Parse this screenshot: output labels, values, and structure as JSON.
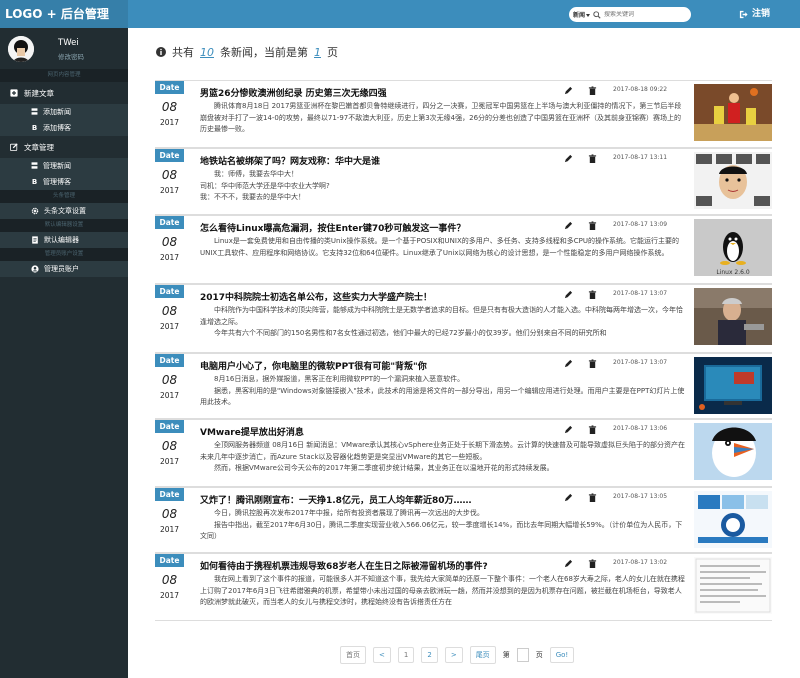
{
  "header": {
    "logo": "LOGO + 后台管理",
    "search_select": "新闻",
    "search_placeholder": "搜索关键词",
    "logout_label": "注销"
  },
  "user": {
    "name": "TWei",
    "subtitle": "修改密码"
  },
  "sidebar": {
    "sec1": "网页内容管理",
    "group1": "新建文章",
    "g1_items": [
      {
        "mark": "〓",
        "label": "添加新闻"
      },
      {
        "mark": "B",
        "label": "添加博客"
      }
    ],
    "group2": "文章管理",
    "g2_items": [
      {
        "mark": "〓",
        "label": "管理新闻"
      },
      {
        "mark": "B",
        "label": "管理博客"
      }
    ],
    "sec2": "头条管理",
    "headline_settings": "头条文章设置",
    "sec3": "默认编辑器设置",
    "default_editor": "默认编辑器",
    "sec4": "管理员账户设置",
    "admin_account": "管理员账户"
  },
  "summary": {
    "prefix": "共有",
    "count": "10",
    "middle": "条新闻，当前是第",
    "page": "1",
    "suffix": "页"
  },
  "articles": [
    {
      "date_label": "Date",
      "day": "08",
      "year": "2017",
      "title": "男篮26分惨败澳洲创纪录 历史第三次无缘四强",
      "time": "2017-08-18 09:22",
      "body": "　　腾讯体育8月18日 2017男篮亚洲杯在黎巴嫩首都贝鲁特继续进行，四分之一决赛，卫冕冠军中国男篮在上半场与澳大利亚僵持的情况下，第三节后半段崩盘被对手打了一波14-0的攻势，最终以71-97不敌澳大利亚，历史上第3次无缘4强，26分的分差也创造了中国男篮在亚洲杯（及其前身亚锦赛）赛场上的历史最惨一败。"
    },
    {
      "date_label": "Date",
      "day": "08",
      "year": "2017",
      "title": "地铁站名被绑架了吗？网友戏称：华中大是谁",
      "time": "2017-08-17 13:11",
      "body": "　　我：师傅，我要去华中大！\n司机：华中师范大学还是华中农业大学啊?\n我：不不不，我要去的是华中大！"
    },
    {
      "date_label": "Date",
      "day": "08",
      "year": "2017",
      "title": "怎么看待Linux曝高危漏洞，按住Enter键70秒可触发这一事件？",
      "time": "2017-08-17 13:09",
      "body": "　　Linux是一套免费使用和自由传播的类Unix操作系统。是一个基于POSIX和UNIX的多用户、多任务、支持多线程和多CPU的操作系统。它能运行主要的UNIX工具软件、应用程序和网络协议。它支持32位和64位硬件。Linux继承了Unix以网络为核心的设计思想，是一个性能稳定的多用户网络操作系统。"
    },
    {
      "date_label": "Date",
      "day": "08",
      "year": "2017",
      "title": "2017中科院院士初选名单公布，这些实力大学盛产院士！",
      "time": "2017-08-17 13:07",
      "body": "　　中科院作为中国科学技术的顶尖阵营，能够成为中科院院士是无数学者追求的目标。但是只有有极大造诣的人才能入选。中科院每两年增选一次，今年恰逢增选之际。\n　　今年共有六个不同部门的150名男性和7名女性通过初选，他们中最大的已经72岁最小的仅39岁。他们分别来自不同的研究所和"
    },
    {
      "date_label": "Date",
      "day": "08",
      "year": "2017",
      "title": "电脑用户小心了，你电脑里的微软PPT很有可能\"背叛\"你",
      "time": "2017-08-17 13:07",
      "body": "　　8月16日消息，据外媒报道，黑客正在利用微软PPT的一个漏洞来植入恶意软件。\n　　据悉，黑客利用的是\"Windows对象链接嵌入\"技术，此技术的用途是将文件的一部分导出，用另一个编辑应用进行处理。而用户主要是在PPT幻灯片上使用此技术。"
    },
    {
      "date_label": "Date",
      "day": "08",
      "year": "2017",
      "title": "VMware提早放出好消息",
      "time": "2017-08-17 13:06",
      "body": "　　全顶网服务器频道 08月16日 新闻消息：VMware承认其核心vSphere业务正处于长期下滑态势。云计算的快速普及可能导致虚拟巨头陷于的部分资产在未来几年中逐步消亡，而Azure Stack以及容器化趋势更是突显出VMware的其它一些短板。\n　　然而，根据VMware公司今天公布的2017年第二季度初步统计结果，其业务正在以温地开花的形式持续发展。"
    },
    {
      "date_label": "Date",
      "day": "08",
      "year": "2017",
      "title": "又炸了！腾讯刚刚宣布：一天挣1.8亿元，员工人均年薪近80万……",
      "time": "2017-08-17 13:05",
      "body": "　　今日，腾讯控股再次发布2017年中报，给所有投资者展现了腾讯再一次远出的大步伐。\n　　报告中指出，截至2017年6月30日，腾讯二季度实现营业收入566.06亿元，较一季度增长14%，而比去年同期大幅增长59%。（计价单位为人民币，下文同）"
    },
    {
      "date_label": "Date",
      "day": "08",
      "year": "2017",
      "title": "如何看待由于携程机票违规导致68岁老人在生日之际被滞留机场的事件?",
      "time": "2017-08-17 13:02",
      "body": "　　我在网上看到了这个事件的报道，可能很多人并不知道这个事，我先给大家简单的还原一下整个事件：一个老人在68岁大寿之际，老人的女儿在就在携程上订购了2017年6月3日飞往希腊雅典的机票，希望带小未出过国的母亲去欧洲玩一趟，然而并没想到的是因为机票存在问题，被拦截在机场柜台，导致老人的欧洲梦就此破灭，而当老人的女儿与携程交涉时，携程始终没有告诉搭责任方在"
    }
  ],
  "pagination": {
    "first": "首页",
    "prev": "<",
    "page1": "1",
    "page2": "2",
    "next": ">",
    "last": "尾页",
    "goto_prefix": "第",
    "goto_suffix": "页",
    "go": "Go!"
  }
}
